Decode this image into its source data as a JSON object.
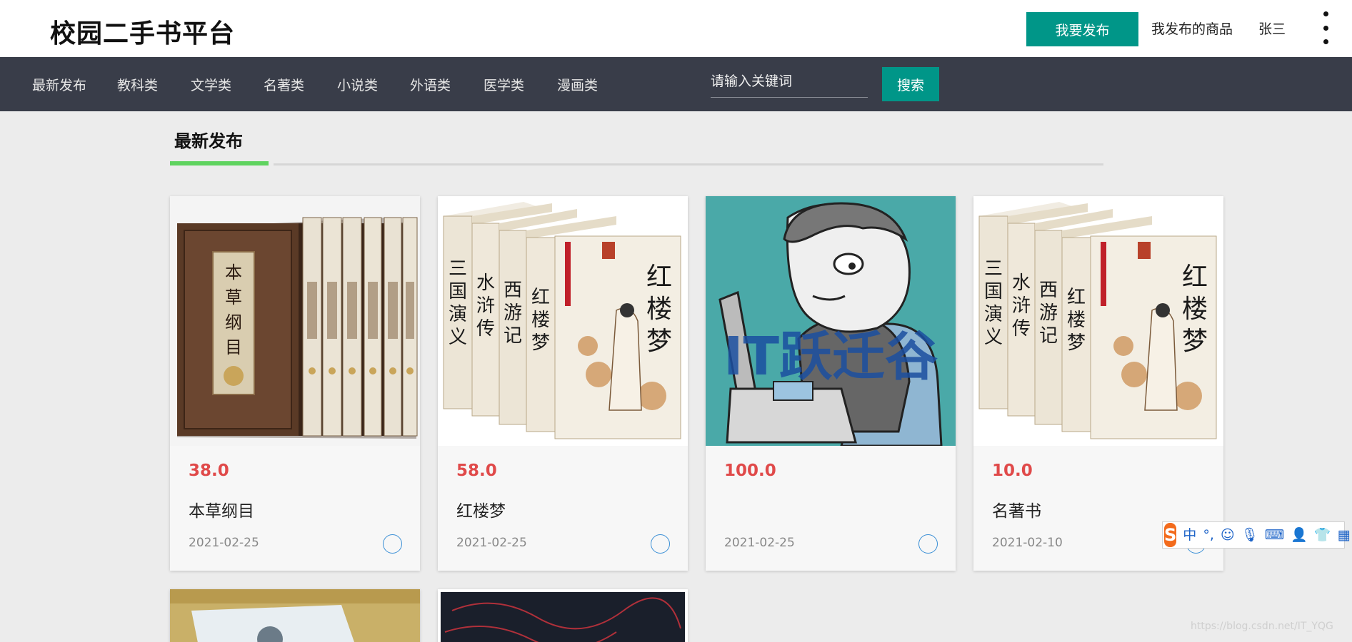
{
  "header": {
    "logo": "校园二手书平台",
    "publish_label": "我要发布",
    "my_goods_label": "我发布的商品",
    "username": "张三"
  },
  "nav": {
    "items": [
      "最新发布",
      "教科类",
      "文学类",
      "名著类",
      "小说类",
      "外语类",
      "医学类",
      "漫画类"
    ],
    "search_placeholder": "请输入关键词",
    "search_label": "搜索"
  },
  "section": {
    "title": "最新发布"
  },
  "books": [
    {
      "price": "38.0",
      "title": "本草纲目",
      "date": "2021-02-25"
    },
    {
      "price": "58.0",
      "title": "红楼梦",
      "date": "2021-02-25"
    },
    {
      "price": "100.0",
      "title": "",
      "date": "2021-02-25",
      "image_text": "IT跃迁谷"
    },
    {
      "price": "10.0",
      "title": "名著书",
      "date": "2021-02-10"
    }
  ],
  "ime": {
    "logo": "S",
    "mode": "中",
    "punct": "°,"
  },
  "watermark": "https://blog.csdn.net/IT_YQG",
  "colors": {
    "accent": "#009688",
    "nav_bg": "#393d49",
    "price": "#e04a4a",
    "underline": "#5fd35f"
  }
}
